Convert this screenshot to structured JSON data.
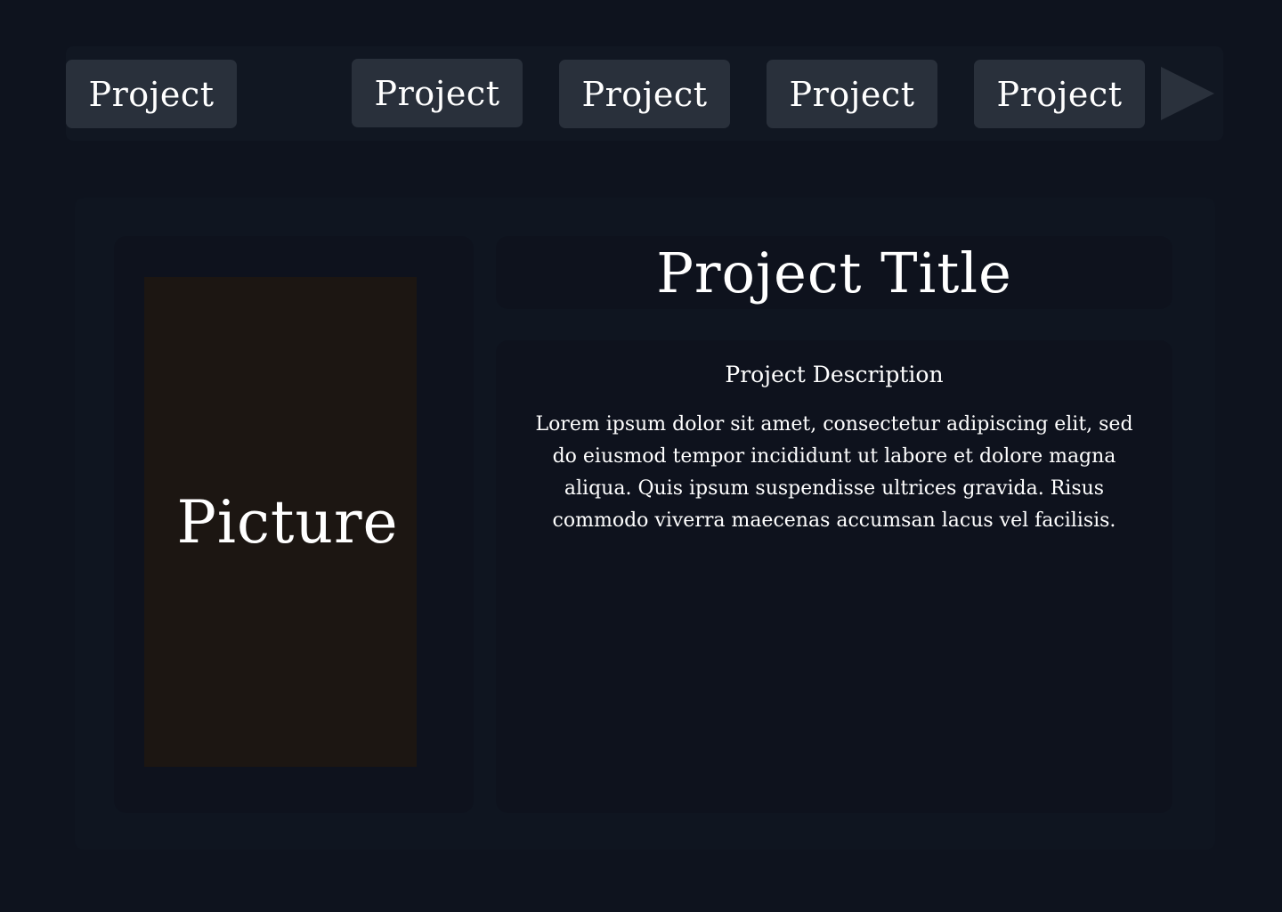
{
  "carousel": {
    "prev_icon": "triangle-left",
    "next_icon": "triangle-right",
    "tabs": [
      {
        "label": "Project"
      },
      {
        "label": "Project"
      },
      {
        "label": "Project"
      },
      {
        "label": "Project"
      },
      {
        "label": "Project"
      }
    ]
  },
  "picture": {
    "label": "Picture"
  },
  "project": {
    "title": "Project Title",
    "description_heading": "Project Description",
    "description_body": "Lorem ipsum dolor sit amet, consectetur adipiscing elit, sed do eiusmod tempor incididunt ut labore et dolore magna aliqua. Quis ipsum suspendisse ultrices gravida. Risus commodo viverra maecenas accumsan lacus vel facilisis."
  },
  "colors": {
    "background": "#0e131e",
    "carousel_bar": "#111722",
    "tab": "#29303b",
    "arrow": "#2a313c",
    "panel": "#0f1520",
    "card": "#0e121d",
    "picture_placeholder": "#1c1612",
    "text": "#ffffff"
  }
}
